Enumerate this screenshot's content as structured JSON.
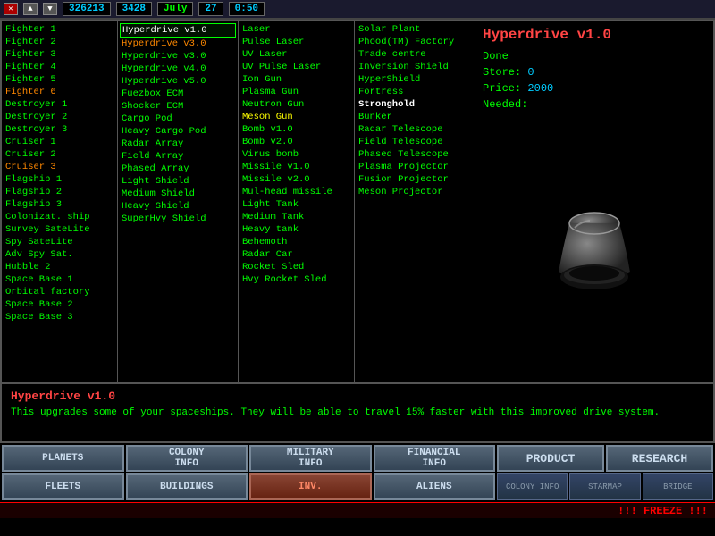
{
  "topbar": {
    "resources": "326213",
    "production": "3428",
    "month": "July",
    "day": "27",
    "time": "0:50"
  },
  "ships": [
    {
      "label": "Fighter 1",
      "class": "normal"
    },
    {
      "label": "Fighter 2",
      "class": "normal"
    },
    {
      "label": "Fighter 3",
      "class": "normal"
    },
    {
      "label": "Fighter 4",
      "class": "normal"
    },
    {
      "label": "Fighter 5",
      "class": "normal"
    },
    {
      "label": "Fighter 6",
      "class": "orange"
    },
    {
      "label": "Destroyer 1",
      "class": "normal"
    },
    {
      "label": "Destroyer 2",
      "class": "normal"
    },
    {
      "label": "Destroyer 3",
      "class": "normal"
    },
    {
      "label": "Cruiser 1",
      "class": "normal"
    },
    {
      "label": "Cruiser 2",
      "class": "normal"
    },
    {
      "label": "Cruiser 3",
      "class": "orange"
    },
    {
      "label": "Flagship 1",
      "class": "normal"
    },
    {
      "label": "Flagship 2",
      "class": "normal"
    },
    {
      "label": "Flagship 3",
      "class": "normal"
    },
    {
      "label": "Colonizat. ship",
      "class": "normal"
    },
    {
      "label": "Survey SateLite",
      "class": "normal"
    },
    {
      "label": "Spy SateLite",
      "class": "normal"
    },
    {
      "label": "Adv Spy Sat.",
      "class": "normal"
    },
    {
      "label": "Hubble 2",
      "class": "normal"
    },
    {
      "label": "Space Base 1",
      "class": "normal"
    },
    {
      "label": "Orbital factory",
      "class": "normal"
    },
    {
      "label": "Space Base 2",
      "class": "normal"
    },
    {
      "label": "Space Base 3",
      "class": "normal"
    }
  ],
  "equipment": [
    {
      "label": "Hyperdrive v1.0",
      "class": "selected"
    },
    {
      "label": "Hyperdrive v3.0",
      "class": "orange"
    },
    {
      "label": "Hyperdrive v3.0",
      "class": "normal"
    },
    {
      "label": "Hyperdrive v4.0",
      "class": "normal"
    },
    {
      "label": "Hyperdrive v5.0",
      "class": "normal"
    },
    {
      "label": "Fuezbox ECM",
      "class": "normal"
    },
    {
      "label": "Shocker ECM",
      "class": "normal"
    },
    {
      "label": "Cargo Pod",
      "class": "normal"
    },
    {
      "label": "Heavy Cargo Pod",
      "class": "normal"
    },
    {
      "label": "Radar Array",
      "class": "normal"
    },
    {
      "label": "Field Array",
      "class": "normal"
    },
    {
      "label": "Phased Array",
      "class": "normal"
    },
    {
      "label": "Light Shield",
      "class": "normal"
    },
    {
      "label": "Medium Shield",
      "class": "normal"
    },
    {
      "label": "Heavy Shield",
      "class": "normal"
    },
    {
      "label": "SuperHvy Shield",
      "class": "normal"
    }
  ],
  "weapons": [
    {
      "label": "Laser",
      "class": "normal"
    },
    {
      "label": "Pulse Laser",
      "class": "normal"
    },
    {
      "label": "UV Laser",
      "class": "normal"
    },
    {
      "label": "UV Pulse Laser",
      "class": "normal"
    },
    {
      "label": "Ion Gun",
      "class": "normal"
    },
    {
      "label": "Plasma Gun",
      "class": "normal"
    },
    {
      "label": "Neutron Gun",
      "class": "normal"
    },
    {
      "label": "Meson Gun",
      "class": "yellow"
    },
    {
      "label": "Bomb v1.0",
      "class": "normal"
    },
    {
      "label": "Bomb v2.0",
      "class": "normal"
    },
    {
      "label": "Virus bomb",
      "class": "normal"
    },
    {
      "label": "Missile v1.0",
      "class": "normal"
    },
    {
      "label": "Missile v2.0",
      "class": "normal"
    },
    {
      "label": "Mul-head missile",
      "class": "normal"
    },
    {
      "label": "Light Tank",
      "class": "normal"
    },
    {
      "label": "Medium Tank",
      "class": "normal"
    },
    {
      "label": "Heavy tank",
      "class": "normal"
    },
    {
      "label": "Behemoth",
      "class": "normal"
    },
    {
      "label": "Radar Car",
      "class": "normal"
    },
    {
      "label": "Rocket Sled",
      "class": "normal"
    },
    {
      "label": "Hvy Rocket Sled",
      "class": "normal"
    }
  ],
  "structures": [
    {
      "label": "Solar Plant",
      "class": "normal"
    },
    {
      "label": "Phood(TM) Factory",
      "class": "normal"
    },
    {
      "label": "Trade centre",
      "class": "normal"
    },
    {
      "label": "Inversion Shield",
      "class": "normal"
    },
    {
      "label": "HyperShield",
      "class": "normal"
    },
    {
      "label": "Fortress",
      "class": "normal"
    },
    {
      "label": "Stronghold",
      "class": "bold"
    },
    {
      "label": "Bunker",
      "class": "normal"
    },
    {
      "label": "Radar Telescope",
      "class": "normal"
    },
    {
      "label": "Field Telescope",
      "class": "normal"
    },
    {
      "label": "Phased Telescope",
      "class": "normal"
    },
    {
      "label": "Plasma Projector",
      "class": "normal"
    },
    {
      "label": "Fusion Projector",
      "class": "normal"
    },
    {
      "label": "Meson Projector",
      "class": "normal"
    }
  ],
  "detail": {
    "title": "Hyperdrive v1.0",
    "done_label": "Done",
    "store_label": "Store:",
    "store_value": "0",
    "price_label": "Price:",
    "price_value": "2000",
    "needed_label": "Needed:"
  },
  "description": {
    "title": "Hyperdrive v1.0",
    "text": "This upgrades some of your spaceships. They will be able to travel\n15% faster with this improved drive system."
  },
  "buttons": {
    "row1": [
      {
        "label": "PLANETS",
        "active": false
      },
      {
        "label": "COLONY\nINFO",
        "active": false
      },
      {
        "label": "MILITARY\nINFO",
        "active": false
      },
      {
        "label": "FINANCIAL\nINFO",
        "active": false
      }
    ],
    "row2": [
      {
        "label": "FLEETS",
        "active": false
      },
      {
        "label": "BUILDINGS",
        "active": false
      },
      {
        "label": "INV.",
        "active": true
      },
      {
        "label": "ALIENS",
        "active": false
      }
    ],
    "right": [
      {
        "label": "PRODUCT"
      },
      {
        "label": "RESEARCH"
      }
    ]
  },
  "statusbar": {
    "freeze_text": "!!! FREEZE !!!"
  }
}
